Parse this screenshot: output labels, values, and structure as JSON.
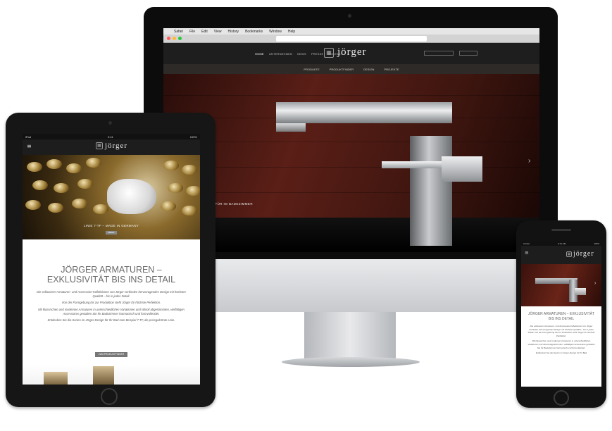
{
  "imac": {
    "menubar": [
      "Safari",
      "File",
      "Edit",
      "View",
      "History",
      "Bookmarks",
      "Window",
      "Help"
    ],
    "menubar_right": "",
    "url": "",
    "nav": [
      {
        "label": "HOME",
        "active": true
      },
      {
        "label": "UNTERNEHMEN",
        "active": false
      },
      {
        "label": "NEWS",
        "active": false
      },
      {
        "label": "PRESSE",
        "active": false
      },
      {
        "label": "KONTAKT",
        "active": false
      }
    ],
    "logo_text": "jörger",
    "search_placeholder": "",
    "lang": "",
    "subnav": [
      "PRODUKTE",
      "PRODUKTFINDER",
      "DESIGN",
      "PROJEKTE"
    ],
    "hero_caption": "ARMATUREN FÜR IM BADEZIMMER",
    "hero_arrow": "›"
  },
  "ipad": {
    "status_left": "iPad",
    "status_center": "9:41",
    "status_right": "100%",
    "menu_icon": "≡",
    "logo_text": "jörger",
    "hero_caption": "LINIE 7-TF – MADE IN GERMANY",
    "hero_button": "MEHR",
    "title": "JÖRGER ARMATUREN – EXKLUSIVITÄT BIS INS DETAIL",
    "body": [
      "Die exklusiven Armaturen- und Accessoire-Kollektionen von Jörger verbinden hervorragendes Design mit höchster Qualität – bis in jedes Detail.",
      "Von der Formgebung bis zur Produktion steht Jörger für höchste Perfektion.",
      "Mit klassischen und modernen Armaturen in unterschiedlichen Variationen und stilvoll abgestimmten, vielfältigen Accessoires gestalten Sie Ihr Badezimmer harmonisch und formvollendet.",
      "Entdecken Sie die Serien im Jörger-Design für Ihr Bad zum Beispiel 7-TF, die preisgekrönte Linie."
    ],
    "button": "ZUM PRODUKTFINDER"
  },
  "iphone": {
    "status_left": "Carrier",
    "status_center": "9:41 AM",
    "status_right": "100%",
    "menu_icon": "≡",
    "logo_text": "jörger",
    "hero_arrow": "›",
    "title": "JÖRGER ARMATUREN – EXKLUSIVITÄT BIS INS DETAIL",
    "body": [
      "Die exklusiven Armaturen- und Accessoire-Kollektionen von Jörger verbinden hervorragendes Design mit höchster Qualität – bis in jedes Detail. Von der Formgebung bis zur Produktion steht Jörger für höchste Perfektion.",
      "Mit klassischen und modernen Armaturen in unterschiedlichen Variationen und stilvoll abgestimmten, vielfältigen Accessoires gestalten Sie Ihr Badezimmer harmonisch und formvollendet.",
      "Entdecken Sie die Serien im Jörger-Design für Ihr Bad"
    ]
  },
  "colors": {
    "header_bg": "#1e1e1e",
    "subnav_bg": "#2e2a27",
    "title_gray": "#6a6a6a"
  }
}
